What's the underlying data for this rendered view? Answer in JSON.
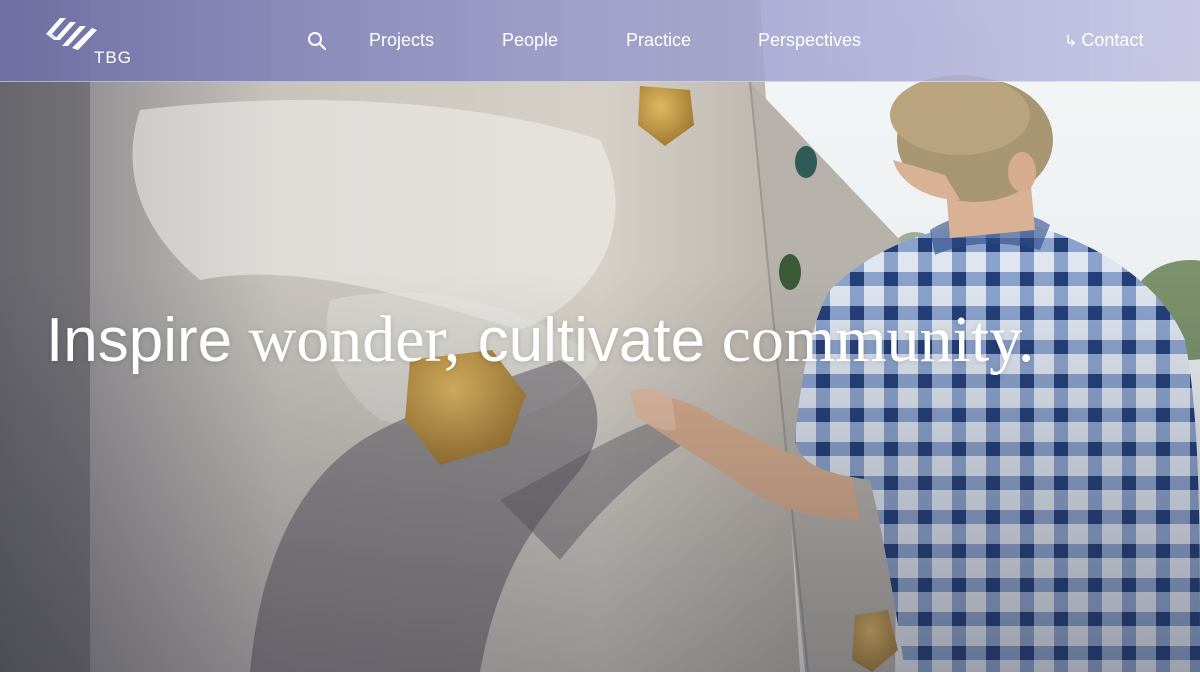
{
  "header": {
    "logo_text": "TBG",
    "nav": [
      {
        "label": "Projects"
      },
      {
        "label": "People"
      },
      {
        "label": "Practice"
      },
      {
        "label": "Perspectives"
      }
    ],
    "contact": {
      "arrow": "↳",
      "label": "Contact"
    }
  },
  "hero": {
    "headline": {
      "part1": "Inspire",
      "part2": " wonder,",
      "part3": " cultivate",
      "part4": " community."
    }
  },
  "icons": {
    "search": "search-icon",
    "logo": "tbg-logo-mark"
  },
  "colors": {
    "header_tint": "#8e8ec8",
    "text": "#ffffff",
    "shirt_blue": "#3f5f9a"
  }
}
